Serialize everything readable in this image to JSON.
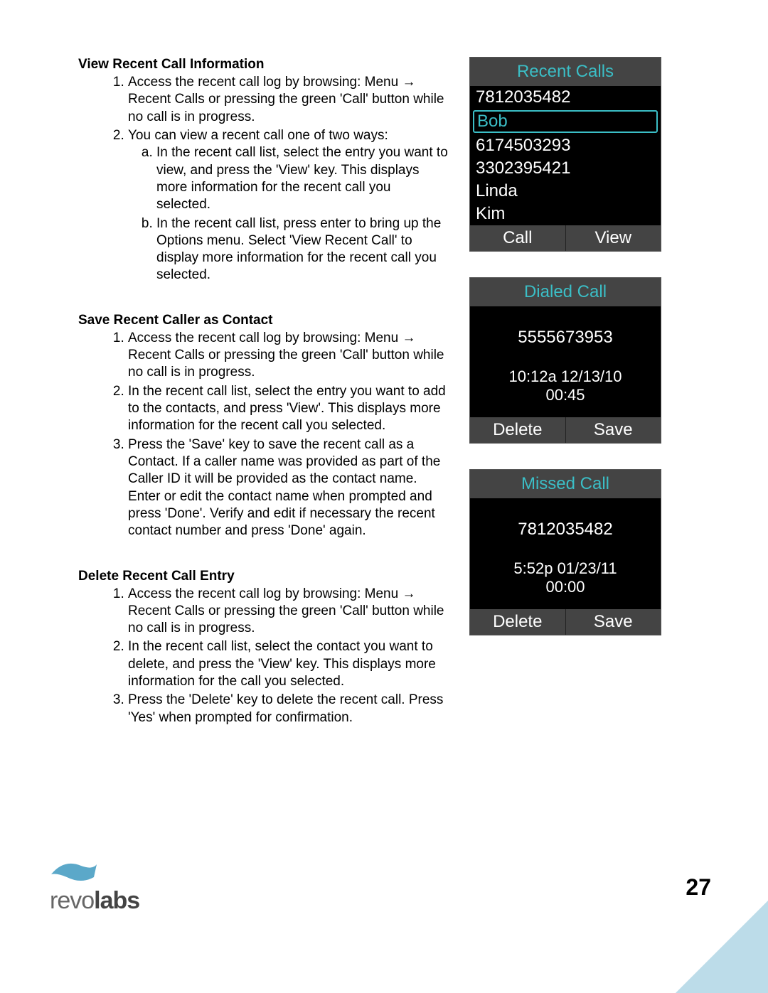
{
  "sections": [
    {
      "heading": "View Recent Call Information",
      "items": [
        "Access the recent call log by browsing: Menu → Recent Calls or pressing the green 'Call' button while no call is in progress.",
        "You can view a recent call one of two ways:"
      ],
      "subitems": [
        "In the recent call list, select the entry you want to view, and press the 'View' key. This displays more information for the recent call you selected.",
        "In the recent call list, press enter to bring up the Options menu.  Select 'View Recent Call' to display more information for the recent call you selected."
      ]
    },
    {
      "heading": "Save Recent Caller as Contact",
      "items": [
        "Access the recent call log by browsing: Menu → Recent Calls or pressing the green 'Call' button while no call is in progress.",
        "In the recent call list, select the entry you want to add to the contacts, and press 'View'. This displays more information for the recent call you selected.",
        "Press the 'Save' key to save the recent call as a Contact. If a caller name was provided as part of the Caller ID it will be provided as the contact name.  Enter or edit the contact name when prompted and press 'Done'. Verify and edit if necessary the recent contact number and press 'Done' again."
      ]
    },
    {
      "heading": "Delete Recent Call Entry",
      "items": [
        "Access the recent call log by browsing: Menu → Recent Calls or pressing the green 'Call' button while no call is in progress.",
        "In the recent call list, select the contact you want to delete, and press the 'View' key. This displays more information for the call you selected.",
        "Press the 'Delete' key to delete the recent call. Press 'Yes' when prompted for confirmation."
      ]
    }
  ],
  "screens": {
    "recent": {
      "title": "Recent Calls",
      "rows": [
        "7812035482",
        "Bob",
        "6174503293",
        "3302395421",
        "Linda",
        "Kim"
      ],
      "selected_index": 1,
      "btn_left": "Call",
      "btn_right": "View"
    },
    "dialed": {
      "title": "Dialed Call",
      "number": "5555673953",
      "timestamp": "10:12a 12/13/10",
      "duration": "00:45",
      "btn_left": "Delete",
      "btn_right": "Save"
    },
    "missed": {
      "title": "Missed Call",
      "number": "7812035482",
      "timestamp": "5:52p 01/23/11",
      "duration": "00:00",
      "btn_left": "Delete",
      "btn_right": "Save"
    }
  },
  "footer": {
    "brand_a": "revo",
    "brand_b": "labs",
    "page_number": "27"
  }
}
